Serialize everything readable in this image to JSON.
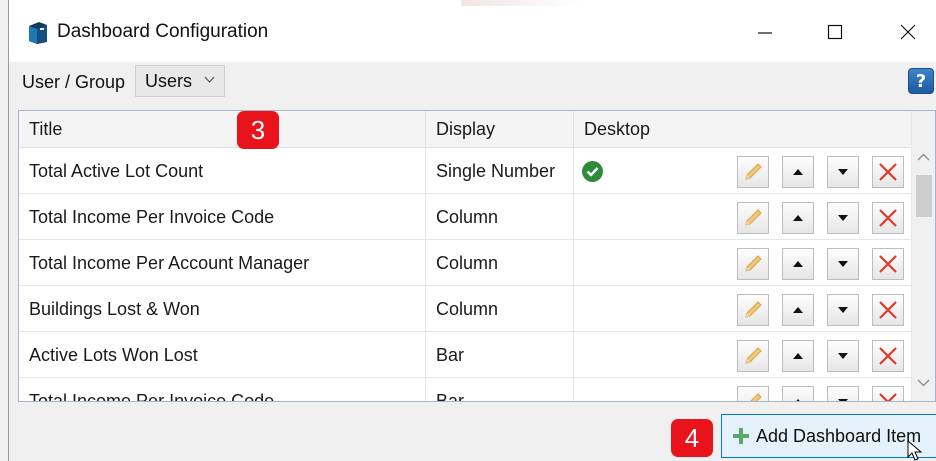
{
  "window": {
    "title": "Dashboard Configuration",
    "controls": {
      "minimize": "—",
      "maximize": "☐",
      "close": "✕"
    }
  },
  "toolbar": {
    "user_group_label": "User / Group",
    "user_group_value": "Users",
    "help_label": "?"
  },
  "grid": {
    "columns": [
      "Title",
      "Display",
      "Desktop"
    ],
    "rows": [
      {
        "title": "Total Active Lot Count",
        "display": "Single Number",
        "desktop": true
      },
      {
        "title": "Total Income Per Invoice Code",
        "display": "Column",
        "desktop": false
      },
      {
        "title": "Total Income Per Account Manager",
        "display": "Column",
        "desktop": false
      },
      {
        "title": "Buildings Lost & Won",
        "display": "Column",
        "desktop": false
      },
      {
        "title": "Active Lots Won Lost",
        "display": "Bar",
        "desktop": false
      },
      {
        "title": "Total Income Per Invoice Code",
        "display": "Bar",
        "desktop": false
      }
    ]
  },
  "annotations": {
    "badge_3": "3",
    "badge_4": "4"
  },
  "footer": {
    "add_button_label": "Add Dashboard Item"
  },
  "colors": {
    "accent_border": "#0078d7",
    "button_hover_bg": "#e5f1fb",
    "badge_red": "#e8131b",
    "check_green": "#2e8b3a",
    "delete_red": "#e0392b"
  },
  "icons": {
    "app": "app-logo-icon",
    "edit": "pencil-icon",
    "up": "arrow-up-icon",
    "down": "arrow-down-icon",
    "delete": "delete-x-icon",
    "help": "help-icon",
    "add": "plus-icon",
    "desktop_on": "check-circle-icon"
  }
}
